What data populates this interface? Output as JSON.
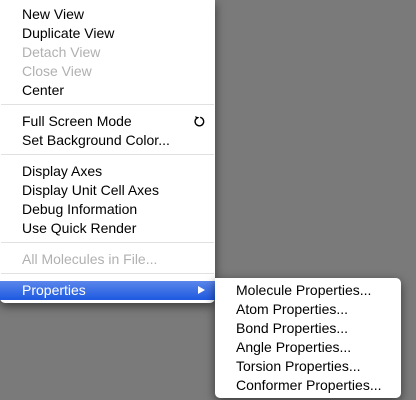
{
  "main_menu": {
    "new_view": "New View",
    "duplicate_view": "Duplicate View",
    "detach_view": "Detach View",
    "close_view": "Close View",
    "center": "Center",
    "full_screen_mode": "Full Screen Mode",
    "set_background_color": "Set Background Color...",
    "display_axes": "Display Axes",
    "display_unit_cell_axes": "Display Unit Cell Axes",
    "debug_information": "Debug Information",
    "use_quick_render": "Use Quick Render",
    "all_molecules_in_file": "All Molecules in File...",
    "properties": "Properties",
    "full_screen_icon": "rotate-arrow-icon",
    "submenu_icon": "triangle-right-icon",
    "highlight_color": "#2a62e4"
  },
  "properties_submenu": {
    "items": [
      "Molecule Properties...",
      "Atom Properties...",
      "Bond Properties...",
      "Angle Properties...",
      "Torsion Properties...",
      "Conformer Properties..."
    ]
  }
}
